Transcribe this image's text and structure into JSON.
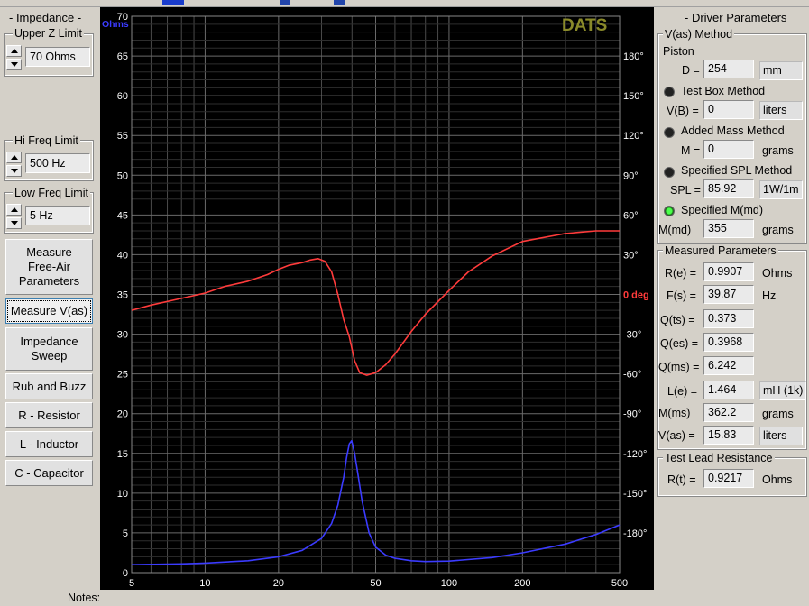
{
  "left": {
    "impedance_title": "- Impedance -",
    "upper_z": {
      "label": "Upper Z Limit",
      "value": "70 Ohms"
    },
    "hi_freq": {
      "label": "Hi Freq Limit",
      "value": "500 Hz"
    },
    "low_freq": {
      "label": "Low Freq Limit",
      "value": "5 Hz"
    },
    "buttons": {
      "measure_free_air": "Measure Free-Air Parameters",
      "measure_vas": "Measure V(as)",
      "impedance_sweep": "Impedance Sweep",
      "rub_buzz": "Rub and Buzz",
      "resistor": "R - Resistor",
      "inductor": "L - Inductor",
      "capacitor": "C - Capacitor"
    }
  },
  "notes_label": "Notes:",
  "chart_data": {
    "type": "line",
    "brand": "DATS",
    "left_axis_unit": "Ohms",
    "right_axis_unit_label": "0 deg",
    "x_scale": "log",
    "xlim": [
      5,
      500
    ],
    "x_ticks": [
      "5",
      "10",
      "20",
      "50",
      "100",
      "200",
      "500"
    ],
    "x_tick_values": [
      5,
      10,
      20,
      50,
      100,
      200,
      500
    ],
    "ylim": [
      0,
      70
    ],
    "y_ticks": [
      "0",
      "5",
      "10",
      "15",
      "20",
      "25",
      "30",
      "35",
      "40",
      "45",
      "50",
      "55",
      "60",
      "65",
      "70"
    ],
    "phase_lim": [
      -210,
      210
    ],
    "phase_ticks": [
      "180°",
      "150°",
      "120°",
      "90°",
      "60°",
      "30°",
      "0 deg",
      "-30°",
      "-60°",
      "-90°",
      "-120°",
      "-150°",
      "-180°"
    ],
    "phase_tick_values": [
      180,
      150,
      120,
      90,
      60,
      30,
      0,
      -30,
      -60,
      -90,
      -120,
      -150,
      -180
    ],
    "grid": true,
    "colors": {
      "background": "#000000",
      "impedance": "#3b3bff",
      "phase": "#ff3b3b",
      "grid": "#4a4a4a",
      "brand": "#8a8a2a",
      "left_ticks": "#ffffff",
      "right_ticks": "#ffffff",
      "phase_zero": "#ff3b3b",
      "ohms_label": "#3b3bff"
    },
    "series": [
      {
        "name": "Impedance",
        "axis": "left",
        "x": [
          5,
          8,
          10,
          15,
          20,
          25,
          30,
          33,
          35,
          37,
          38,
          39,
          39.87,
          41,
          42,
          44,
          47,
          50,
          55,
          60,
          70,
          80,
          100,
          150,
          200,
          300,
          400,
          500
        ],
        "y": [
          1.0,
          1.1,
          1.2,
          1.5,
          2.0,
          2.8,
          4.3,
          6.2,
          8.5,
          12.0,
          14.5,
          16.2,
          16.6,
          15.0,
          13.0,
          9.0,
          5.0,
          3.2,
          2.2,
          1.8,
          1.5,
          1.4,
          1.45,
          1.9,
          2.5,
          3.6,
          4.8,
          6.0
        ]
      },
      {
        "name": "Phase",
        "axis": "right",
        "x": [
          5,
          6,
          8,
          10,
          12,
          15,
          18,
          20,
          22,
          25,
          27,
          29,
          31,
          33,
          35,
          37,
          39,
          41,
          43,
          46,
          50,
          55,
          60,
          70,
          80,
          100,
          120,
          150,
          200,
          300,
          400,
          500
        ],
        "y": [
          -12,
          -8,
          -3,
          1,
          6,
          10,
          15,
          19,
          22,
          24,
          26,
          27,
          25,
          17,
          0,
          -19,
          -32,
          -50,
          -59,
          -61,
          -59,
          -53,
          -45,
          -28,
          -15,
          3,
          17,
          29,
          40,
          46,
          48,
          48
        ]
      }
    ]
  },
  "right": {
    "driver_title": "- Driver Parameters",
    "vas_method": {
      "label": "V(as) Method",
      "piston": "Piston"
    },
    "D": {
      "label": "D =",
      "value": "254",
      "unit": "mm"
    },
    "test_box": {
      "label": "Test Box Method"
    },
    "VB": {
      "label": "V(B) =",
      "value": "0",
      "unit": "liters"
    },
    "added_mass": {
      "label": "Added Mass Method"
    },
    "M": {
      "label": "M =",
      "value": "0",
      "unit": "grams"
    },
    "spl_method": {
      "label": "Specified SPL Method"
    },
    "SPL": {
      "label": "SPL =",
      "value": "85.92",
      "unit": "1W/1m"
    },
    "mmd_method": {
      "label": "Specified M(md)",
      "selected": true
    },
    "Mmd": {
      "label": "M(md)",
      "value": "355",
      "unit": "grams"
    },
    "measured": {
      "title": "Measured Parameters",
      "Re": {
        "label": "R(e) =",
        "value": "0.9907",
        "unit": "Ohms"
      },
      "Fs": {
        "label": "F(s) =",
        "value": "39.87",
        "unit": "Hz"
      },
      "Qts": {
        "label": "Q(ts) =",
        "value": "0.373"
      },
      "Qes": {
        "label": "Q(es) =",
        "value": "0.3968"
      },
      "Qms": {
        "label": "Q(ms) =",
        "value": "6.242"
      },
      "Le": {
        "label": "L(e) =",
        "value": "1.464",
        "unit": "mH (1k)"
      },
      "Mms": {
        "label": "M(ms)",
        "value": "362.2",
        "unit": "grams"
      },
      "Vas": {
        "label": "V(as) =",
        "value": "15.83",
        "unit": "liters"
      }
    },
    "lead": {
      "title": "Test Lead Resistance",
      "Rt": {
        "label": "R(t) =",
        "value": "0.9217",
        "unit": "Ohms"
      }
    }
  }
}
